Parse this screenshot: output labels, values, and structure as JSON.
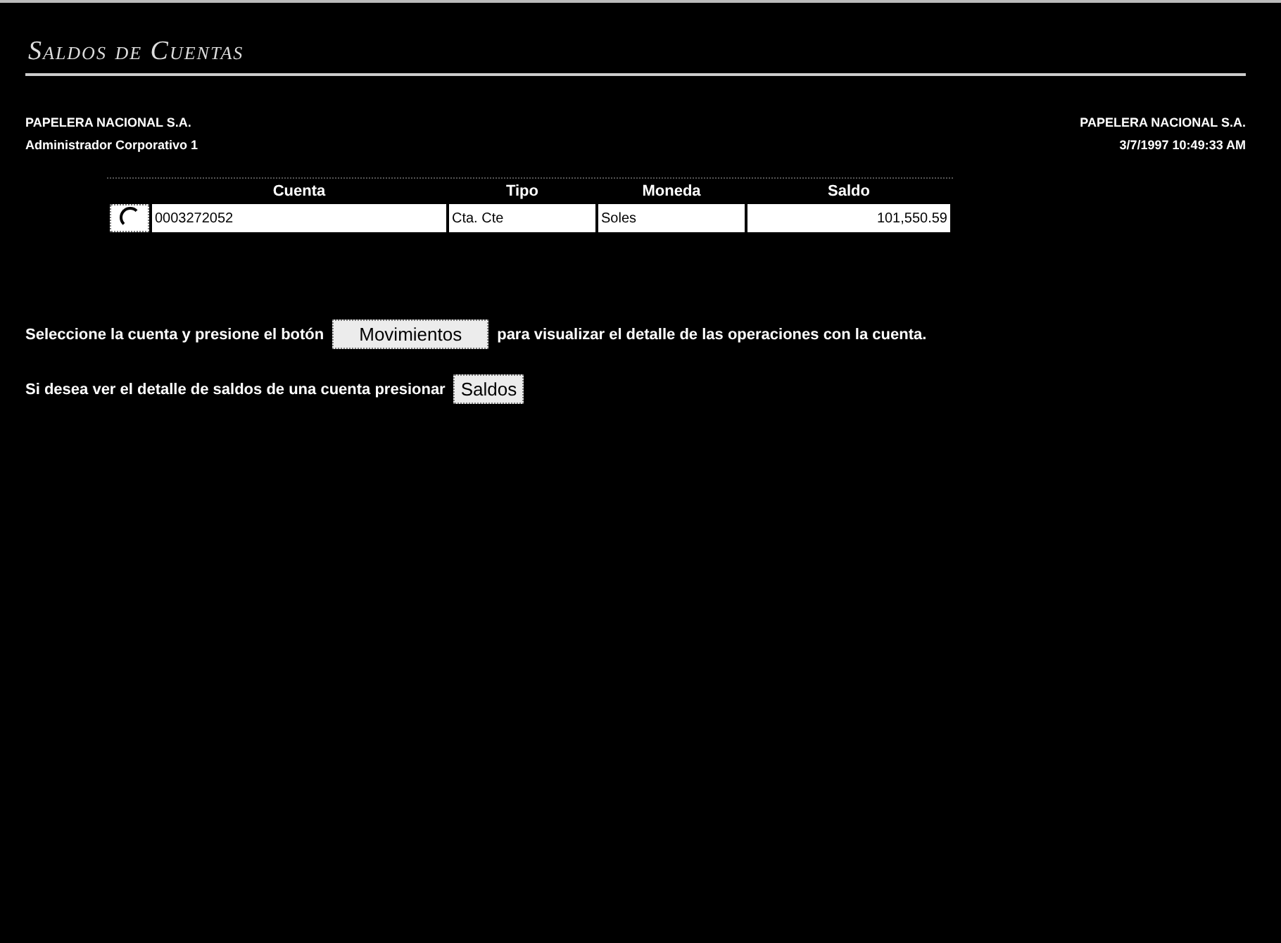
{
  "title": "Saldos de Cuentas",
  "header": {
    "left": [
      "PAPELERA NACIONAL S.A.",
      "Administrador Corporativo 1"
    ],
    "right": [
      "PAPELERA NACIONAL S.A.",
      "3/7/1997 10:49:33 AM"
    ]
  },
  "table": {
    "columns": [
      "Cuenta",
      "Tipo",
      "Moneda",
      "Saldo"
    ],
    "rows": [
      {
        "selected": false,
        "cells": [
          "0003272052",
          "Cta. Cte",
          "Soles",
          "101,550.59"
        ]
      }
    ]
  },
  "instructions": [
    {
      "before": "Seleccione la cuenta y presione el botón",
      "button": "Movimientos",
      "after": "para visualizar el detalle de las operaciones con la cuenta."
    },
    {
      "before": "Si desea ver el detalle de saldos de una cuenta presionar",
      "button": "Saldos"
    }
  ]
}
